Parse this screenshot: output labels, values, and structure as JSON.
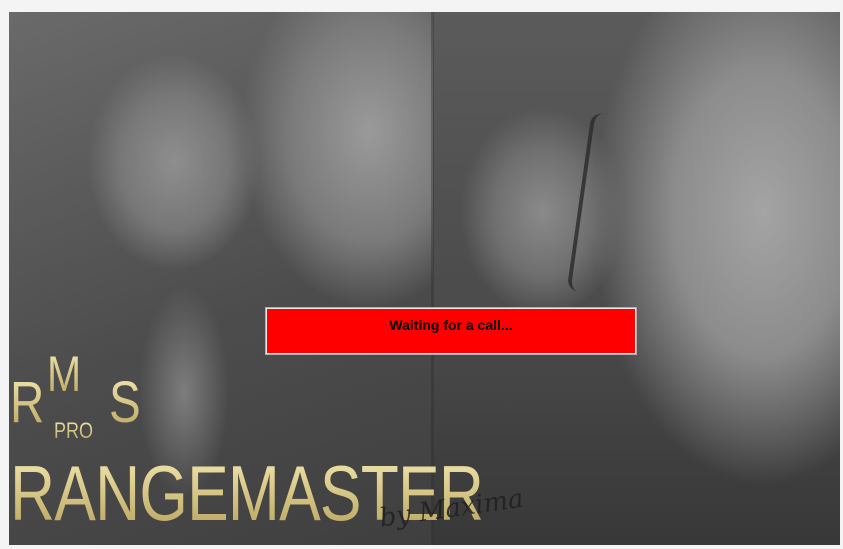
{
  "status": {
    "text": "Waiting for a call...",
    "color": "#ff0000"
  },
  "logo": {
    "r": "R",
    "m": "M",
    "s": "S",
    "pro": "PRO",
    "product": "RANGEMASTER",
    "signature": "by Maxima",
    "color": "#d9c98a"
  }
}
